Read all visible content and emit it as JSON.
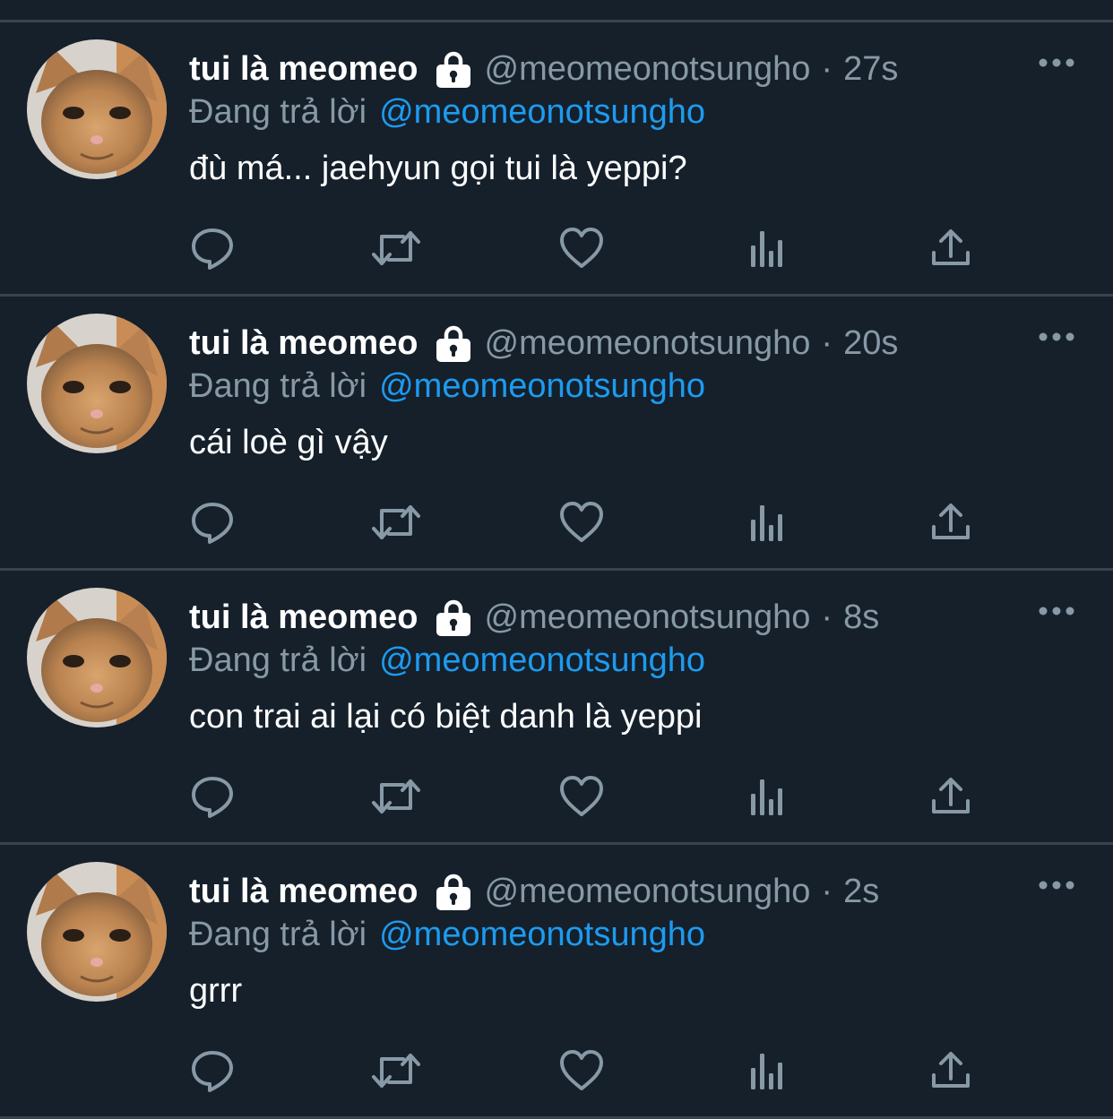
{
  "tweets": [
    {
      "display_name": "tui là meomeo",
      "handle": "@meomeonotsungho",
      "separator": "·",
      "time": "27s",
      "reply_prefix": "Đang trả lời",
      "reply_to": "@meomeonotsungho",
      "text": "đù má... jaehyun gọi tui là yeppi?"
    },
    {
      "display_name": "tui là meomeo",
      "handle": "@meomeonotsungho",
      "separator": "·",
      "time": "20s",
      "reply_prefix": "Đang trả lời",
      "reply_to": "@meomeonotsungho",
      "text": "cái loè gì vậy"
    },
    {
      "display_name": "tui là meomeo",
      "handle": "@meomeonotsungho",
      "separator": "·",
      "time": "8s",
      "reply_prefix": "Đang trả lời",
      "reply_to": "@meomeonotsungho",
      "text": "con trai ai lại có biệt danh là yeppi"
    },
    {
      "display_name": "tui là meomeo",
      "handle": "@meomeonotsungho",
      "separator": "·",
      "time": "2s",
      "reply_prefix": "Đang trả lời",
      "reply_to": "@meomeonotsungho",
      "text": "grrr"
    }
  ],
  "icons": {
    "lock": "lock-icon",
    "more": "more-icon",
    "reply": "reply-icon",
    "retweet": "retweet-icon",
    "like": "heart-icon",
    "stats": "analytics-icon",
    "share": "share-icon"
  },
  "colors": {
    "background": "#15202b",
    "divider": "#38444d",
    "secondary_text": "#8899a6",
    "link": "#1d9bf0",
    "primary_text": "#ffffff"
  }
}
